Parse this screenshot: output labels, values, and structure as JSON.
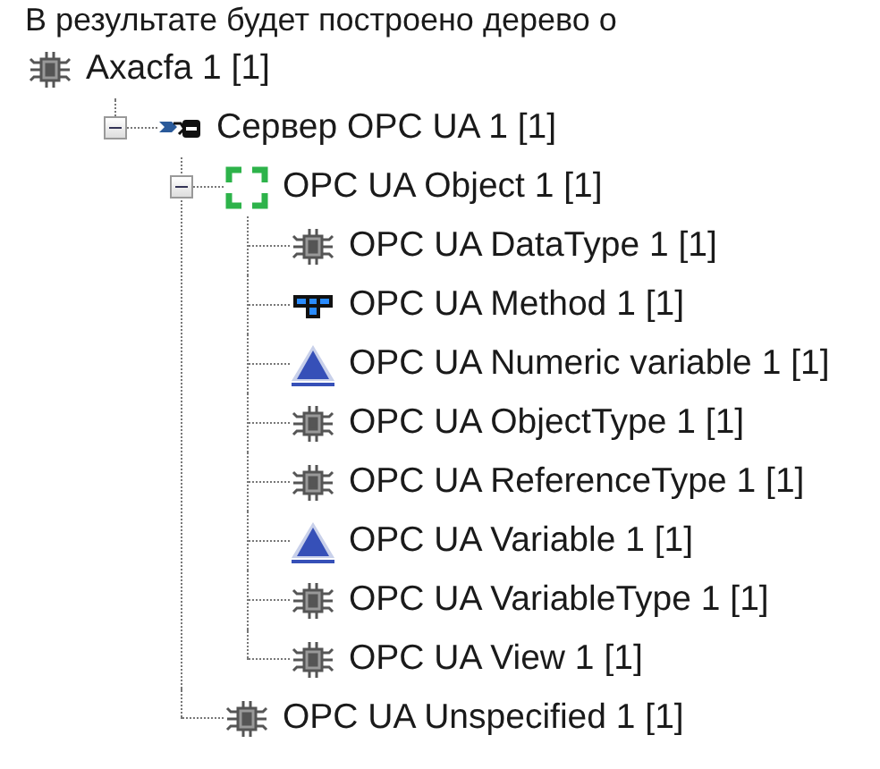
{
  "intro": "В результате будет построено дерево о",
  "tree": [
    {
      "label": "Axacfa 1 [1]",
      "kind": "module",
      "children": [
        {
          "label": "Сервер OPC UA 1 [1]",
          "kind": "server",
          "expanded": true,
          "children": [
            {
              "label": "OPC UA Object 1 [1]",
              "kind": "object",
              "expanded": true,
              "children": [
                {
                  "label": "OPC UA DataType 1 [1]",
                  "kind": "module"
                },
                {
                  "label": "OPC UA Method 1 [1]",
                  "kind": "method"
                },
                {
                  "label": "OPC UA Numeric variable 1 [1]",
                  "kind": "variable"
                },
                {
                  "label": "OPC UA ObjectType 1 [1]",
                  "kind": "module"
                },
                {
                  "label": "OPC UA ReferenceType 1 [1]",
                  "kind": "module"
                },
                {
                  "label": "OPC UA Variable 1 [1]",
                  "kind": "variable"
                },
                {
                  "label": "OPC UA VariableType 1 [1]",
                  "kind": "module"
                },
                {
                  "label": "OPC UA View 1 [1]",
                  "kind": "module"
                }
              ]
            },
            {
              "label": "OPC UA Unspecified 1 [1]",
              "kind": "module"
            }
          ]
        }
      ]
    }
  ]
}
